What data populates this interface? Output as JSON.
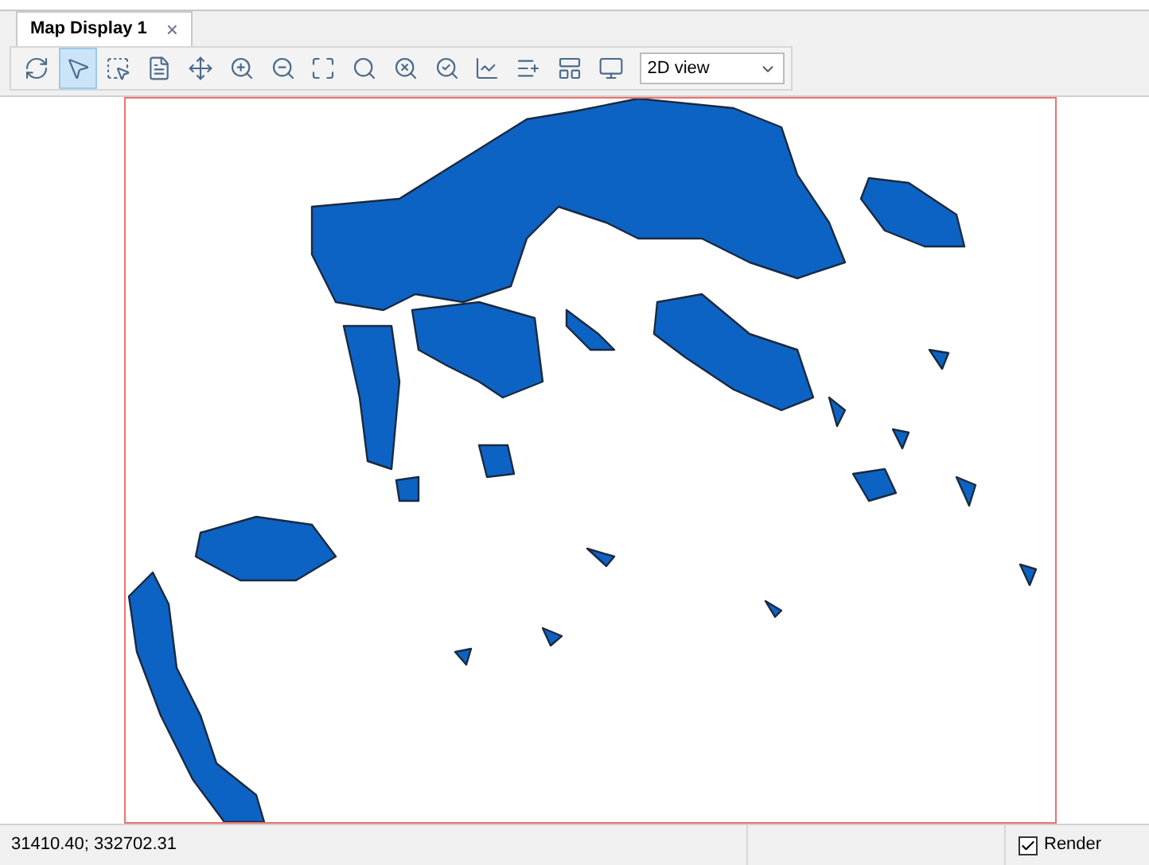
{
  "tab": {
    "title": "Map Display 1",
    "close": "×",
    "selected": true
  },
  "toolbar": {
    "tools": [
      {
        "kind": "refresh",
        "selected": false
      },
      {
        "kind": "pointer",
        "selected": true
      },
      {
        "kind": "select-rect",
        "selected": false
      },
      {
        "kind": "identify",
        "selected": false
      },
      {
        "kind": "pan",
        "selected": false
      },
      {
        "kind": "zoom-in",
        "selected": false
      },
      {
        "kind": "zoom-out",
        "selected": false
      },
      {
        "kind": "zoom-extent",
        "selected": false
      },
      {
        "kind": "zoom-rect",
        "selected": false
      },
      {
        "kind": "zoom-prev",
        "selected": false
      },
      {
        "kind": "zoom-next",
        "selected": false
      },
      {
        "kind": "chart",
        "selected": false
      },
      {
        "kind": "legend",
        "selected": false
      },
      {
        "kind": "layout",
        "selected": false
      },
      {
        "kind": "screen",
        "selected": false
      }
    ],
    "view_select": {
      "value": "2D view"
    }
  },
  "status_bar": {
    "coordinates": "31410.40; 332702.31",
    "render": {
      "label": "Render",
      "checked": true
    }
  }
}
